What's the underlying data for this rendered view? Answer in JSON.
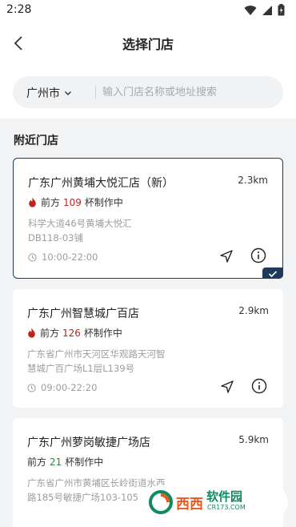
{
  "status_bar": {
    "time": "2:28"
  },
  "header": {
    "title": "选择门店"
  },
  "search": {
    "city": "广州市",
    "placeholder": "输入门店名称或地址搜索"
  },
  "section_title": "附近门店",
  "stores": [
    {
      "name": "广东广州黄埔大悦汇店（新）",
      "distance": "2.3km",
      "queue_prefix": "前方",
      "queue_count": "109",
      "queue_suffix": "杯制作中",
      "hot": true,
      "address_line1": "科学大道46号黄埔大悦汇",
      "address_line2": "DB118-03铺",
      "hours": "10:00-22:00",
      "selected": true
    },
    {
      "name": "广东广州智慧城广百店",
      "distance": "2.9km",
      "queue_prefix": "前方",
      "queue_count": "126",
      "queue_suffix": "杯制作中",
      "hot": true,
      "address_line1": "广东省广州市天河区华观路天河智",
      "address_line2": "慧城广百广场L1层L139号",
      "hours": "09:00-22:20",
      "selected": false
    },
    {
      "name": "广东广州萝岗敏捷广场店",
      "distance": "5.9km",
      "queue_prefix": "前方",
      "queue_count": "21",
      "queue_suffix": "杯制作中",
      "hot": false,
      "address_line1": "广东省广州市黄埔区长岭街道水西",
      "address_line2": "路185号敏捷广场103-105",
      "hours": "",
      "selected": false
    }
  ],
  "colors": {
    "accent": "#1f3b5c",
    "hot": "#c0221c",
    "calm": "#2b8a3e",
    "muted": "#9a9da2"
  },
  "watermark": {
    "brand": "西西",
    "site": "软件园",
    "domain": "CR173.COM"
  }
}
